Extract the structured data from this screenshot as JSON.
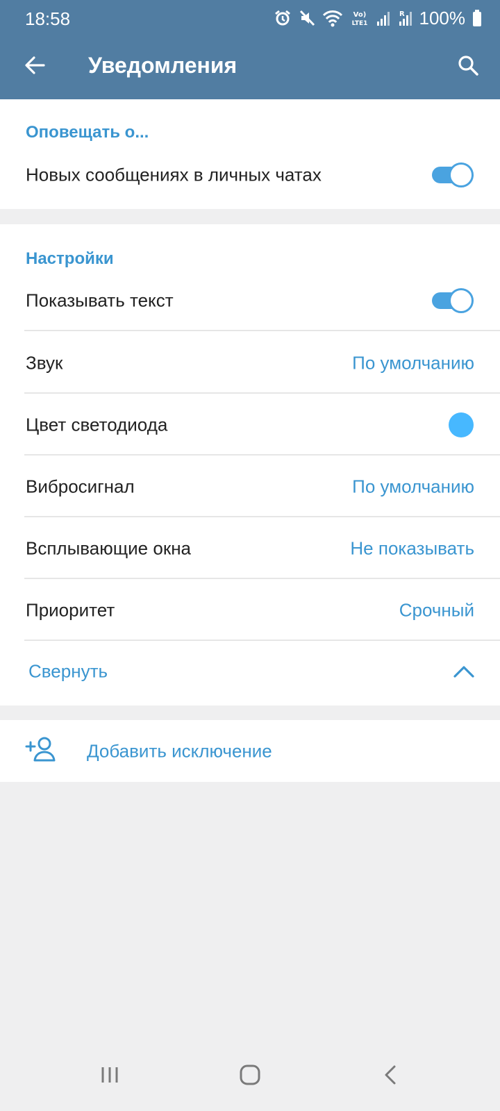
{
  "status_bar": {
    "time": "18:58",
    "battery": "100%",
    "icons": [
      "alarm-icon",
      "mute-icon",
      "wifi-icon",
      "volte-icon",
      "signal-icon",
      "signal-roaming-icon",
      "battery-icon"
    ]
  },
  "toolbar": {
    "title": "Уведомления",
    "back_icon": "arrow-left-icon",
    "search_icon": "search-icon"
  },
  "notify_section": {
    "header": "Оповещать о...",
    "items": [
      {
        "label": "Новых сообщениях в личных чатах",
        "control": "toggle",
        "checked": true
      }
    ]
  },
  "settings_section": {
    "header": "Настройки",
    "items": [
      {
        "label": "Показывать текст",
        "control": "toggle",
        "checked": true
      },
      {
        "label": "Звук",
        "value": "По умолчанию"
      },
      {
        "label": "Цвет светодиода",
        "color": "#47b8ff"
      },
      {
        "label": "Вибросигнал",
        "value": "По умолчанию"
      },
      {
        "label": "Всплывающие окна",
        "value": "Не показывать"
      },
      {
        "label": "Приоритет",
        "value": "Срочный"
      }
    ],
    "collapse_label": "Свернуть"
  },
  "exceptions": {
    "add_label": "Добавить исключение",
    "icon": "add-user-icon"
  },
  "colors": {
    "appbar": "#517da2",
    "accent": "#3a95d0",
    "toggle": "#4aa3e0",
    "background": "#efeff0"
  },
  "nav_bar": {
    "icons": [
      "recent-apps-icon",
      "home-icon",
      "back-icon"
    ]
  }
}
